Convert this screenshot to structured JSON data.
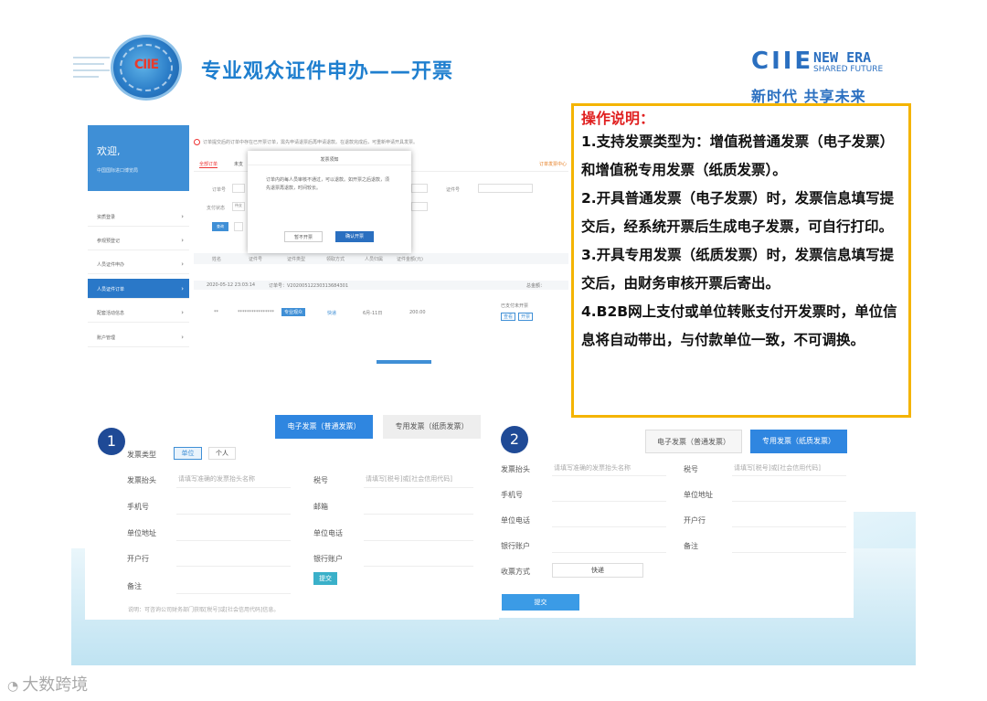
{
  "header": {
    "logo_text": "CIIE",
    "title": "专业观众证件申办——开票",
    "brand_ciie": "CIIE",
    "brand_new_era": "NEW ERA",
    "brand_shared_future": "SHARED FUTURE",
    "slogan": "新时代 共享未来"
  },
  "portal": {
    "welcome": "欢迎,",
    "org": "中国国际进口博览局",
    "nav": [
      "资质登录",
      "参观预登记",
      "人员证件申办",
      "人员证件订单",
      "配套活动信息",
      "账户管理"
    ],
    "notice": "订单提交后的订单中存在已开票订单，需先申请退票后再申请退款。在退款完成后，可重新申请开具发票。",
    "tab_all": "全部订单",
    "tab_unpaid": "未支",
    "invoice_center": "订单发票中心",
    "label_order_no": "订单号",
    "label_pay_status": "支付状态",
    "pay_status_value": "待支",
    "label_cert_no": "证件号",
    "query_button": "查询",
    "table_headers": [
      "姓名",
      "证件号",
      "证件类型",
      "领取方式",
      "人员归属",
      "证件金额(元)"
    ],
    "order_date": "2020-05-12 23:03:14",
    "order_no": "订单号：V20200512230313684301",
    "total_label": "总金额：",
    "row_name": "**",
    "row_cert_no": "****************",
    "row_type": "专业观众",
    "row_method": "快递",
    "row_date": "6月-11日",
    "row_amount": "200.00",
    "row_status": "已支付未开票",
    "action_view": "查看",
    "action_invoice": "开票"
  },
  "modal": {
    "title": "发票须知",
    "body": "订单内的每人员审核不通过，可以退款。如开票之后退款，须先退票再退款，时间较长。",
    "cancel": "暂不开票",
    "confirm": "确认开票"
  },
  "instructions": {
    "heading": "操作说明：",
    "items": [
      "1.支持发票类型为：增值税普通发票（电子发票）和增值税专用发票（纸质发票）。",
      "2.开具普通发票（电子发票）时，发票信息填写提交后，经系统开票后生成电子发票，可自行打印。",
      "3.开具专用发票（纸质发票）时，发票信息填写提交后，由财务审核开票后寄出。",
      "4.B2B网上支付或单位转账支付开发票时，单位信息将自动带出，与付款单位一致，不可调换。"
    ]
  },
  "form1": {
    "step": "1",
    "btn_electronic": "电子发票（普通发票）",
    "btn_special": "专用发票（纸质发票）",
    "label_type": "发票类型",
    "chip_unit": "单位",
    "chip_personal": "个人",
    "label_title": "发票抬头",
    "ph_title": "请填写准确的发票抬头名称",
    "label_tax": "税号",
    "ph_tax": "请填写[税号]或[社会信用代码]",
    "label_phone": "手机号",
    "label_email": "邮箱",
    "label_address": "单位地址",
    "label_unit_phone": "单位电话",
    "label_bank": "开户行",
    "label_account": "银行账户",
    "label_note": "备注",
    "submit": "提交",
    "footnote": "说明：可咨询公司财务部门获取[税号]或[社会信用代码]信息。"
  },
  "form2": {
    "step": "2",
    "btn_electronic": "电子发票（普通发票）",
    "btn_special": "专用发票（纸质发票）",
    "label_title": "发票抬头",
    "ph_title": "请填写准确的发票抬头名称",
    "label_tax": "税号",
    "ph_tax": "请填写[税号]或[社会信用代码]",
    "label_phone": "手机号",
    "label_address": "单位地址",
    "label_unit_phone": "单位电话",
    "label_bank": "开户行",
    "label_account": "银行账户",
    "label_note": "备注",
    "label_delivery": "收票方式",
    "delivery_value": "快递",
    "submit": "提交"
  },
  "watermark": "大数跨境",
  "colors": {
    "accent": "#2f86e0",
    "highlight_border": "#f4b400",
    "heading_red": "#e02020",
    "brand_blue": "#2a6fc0"
  }
}
